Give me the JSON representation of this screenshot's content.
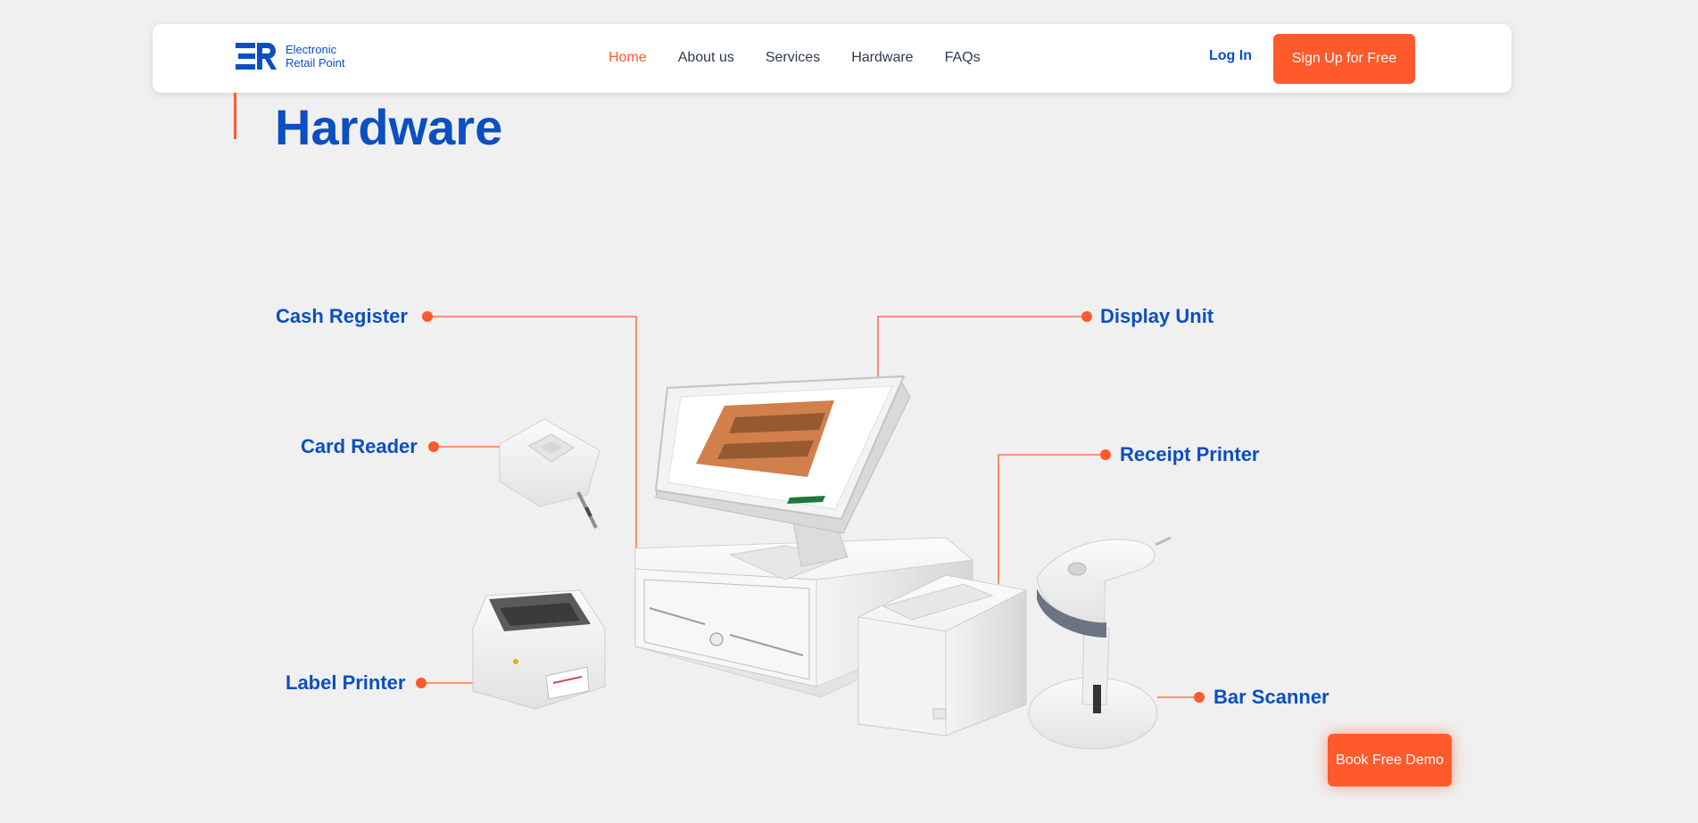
{
  "brand": {
    "logo_mark": "ER",
    "name_line1": "Electronic",
    "name_line2": "Retail Point",
    "accent_color": "#ff5a2c",
    "primary_color": "#0b4fc1"
  },
  "nav": {
    "items": [
      {
        "label": "Home",
        "active": true
      },
      {
        "label": "About us"
      },
      {
        "label": "Services"
      },
      {
        "label": "Hardware"
      },
      {
        "label": "FAQs"
      }
    ],
    "login_label": "Log In",
    "signup_label": "Sign Up for Free"
  },
  "page": {
    "title": "Hardware"
  },
  "hardware": {
    "cash_register": "Cash Register",
    "display_unit": "Display Unit",
    "card_reader": "Card Reader",
    "receipt_printer": "Receipt Printer",
    "label_printer": "Label Printer",
    "bar_scanner": "Bar Scanner"
  },
  "cta": {
    "demo_label": "Book Free Demo"
  }
}
